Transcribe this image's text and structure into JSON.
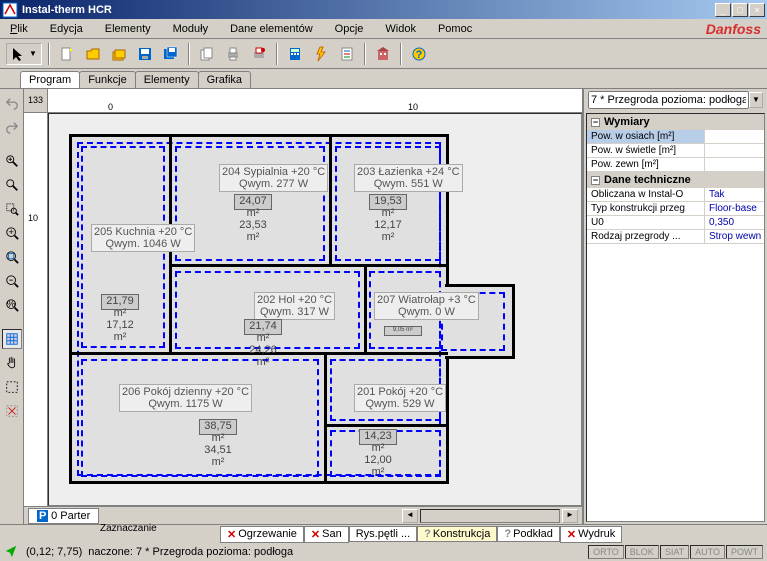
{
  "window": {
    "title": "Instal-therm HCR"
  },
  "menu": {
    "items": [
      "Plik",
      "Edycja",
      "Elementy",
      "Moduły",
      "Dane elementów",
      "Opcje",
      "Widok",
      "Pomoc"
    ],
    "brand": "Danfoss"
  },
  "tabs": {
    "labels": [
      "Program",
      "Funkcje",
      "Elementy",
      "Grafika"
    ],
    "active": 0
  },
  "ruler": {
    "corner": "133",
    "h0": "0",
    "h10": "10",
    "v10": "10"
  },
  "floor_tab": {
    "label": "0 Parter",
    "prefix": "P"
  },
  "rooms": {
    "r1": {
      "label": "205 Kuchnia  +20 °C",
      "sub": "Qwym. 1046 W"
    },
    "r2": {
      "label": "204 Sypialnia  +20 °C",
      "sub": "Qwym. 277 W"
    },
    "r3": {
      "label": "203 Łazienka  +24 °C",
      "sub": "Qwym. 551 W"
    },
    "r4": {
      "label": "202 Hol  +20 °C",
      "sub": "Qwym. 317 W"
    },
    "r5": {
      "label": "207 Wiatrołap  +3 °C",
      "sub": "Qwym. 0 W"
    },
    "r6": {
      "label": "206 Pokój dzienny  +20 °C",
      "sub": "Qwym. 1175 W"
    },
    "r7": {
      "label": "201 Pokój  +20 °C",
      "sub": "Qwym. 529 W"
    }
  },
  "heaters": {
    "h1a": "21,79 m²",
    "h1b": "17,12 m²",
    "h2a": "24,07 m²",
    "h2b": "23,53 m²",
    "h3a": "19,53 m²",
    "h3b": "12,17 m²",
    "h4a": "21,74 m²",
    "h4b": "24,26 m²",
    "h5": "9,05 m²",
    "h6a": "38,75 m²",
    "h6b": "34,51 m²",
    "h7a": "14,23 m²",
    "h7b": "12,00 m²"
  },
  "right_panel": {
    "header": "7 * Przegroda pozioma: podłoga",
    "g1": "Wymiary",
    "rows1": [
      {
        "k": "Pow. w osiach [m²]",
        "v": ""
      },
      {
        "k": "Pow. w świetle [m²]",
        "v": ""
      },
      {
        "k": "Pow. zewn [m²]",
        "v": ""
      }
    ],
    "g2": "Dane techniczne",
    "rows2": [
      {
        "k": "Obliczana w Instal-O",
        "v": "Tak"
      },
      {
        "k": "Typ konstrukcji przeg",
        "v": "Floor-base"
      },
      {
        "k": "U0",
        "v": "0,350"
      },
      {
        "k": "Rodzaj przegrody ...",
        "v": "Strop wewn"
      }
    ]
  },
  "bottom_tabs": {
    "items": [
      {
        "icon": "x",
        "label": "Ogrzewanie"
      },
      {
        "icon": "x",
        "label": "San"
      },
      {
        "icon": "",
        "label": "Rys.pętli ..."
      },
      {
        "icon": "q",
        "label": "Konstrukcja"
      },
      {
        "icon": "q",
        "label": "Podkład"
      },
      {
        "icon": "x",
        "label": "Wydruk"
      }
    ],
    "active": 3
  },
  "status": {
    "mode_label": "Zaznaczanie",
    "coords": "(0,12; 7,75)",
    "selection": "naczone: 7 * Przegroda pozioma: podłoga",
    "modes": [
      "ORTO",
      "BLOK",
      "SIAT",
      "AUTO",
      "POWT"
    ]
  }
}
